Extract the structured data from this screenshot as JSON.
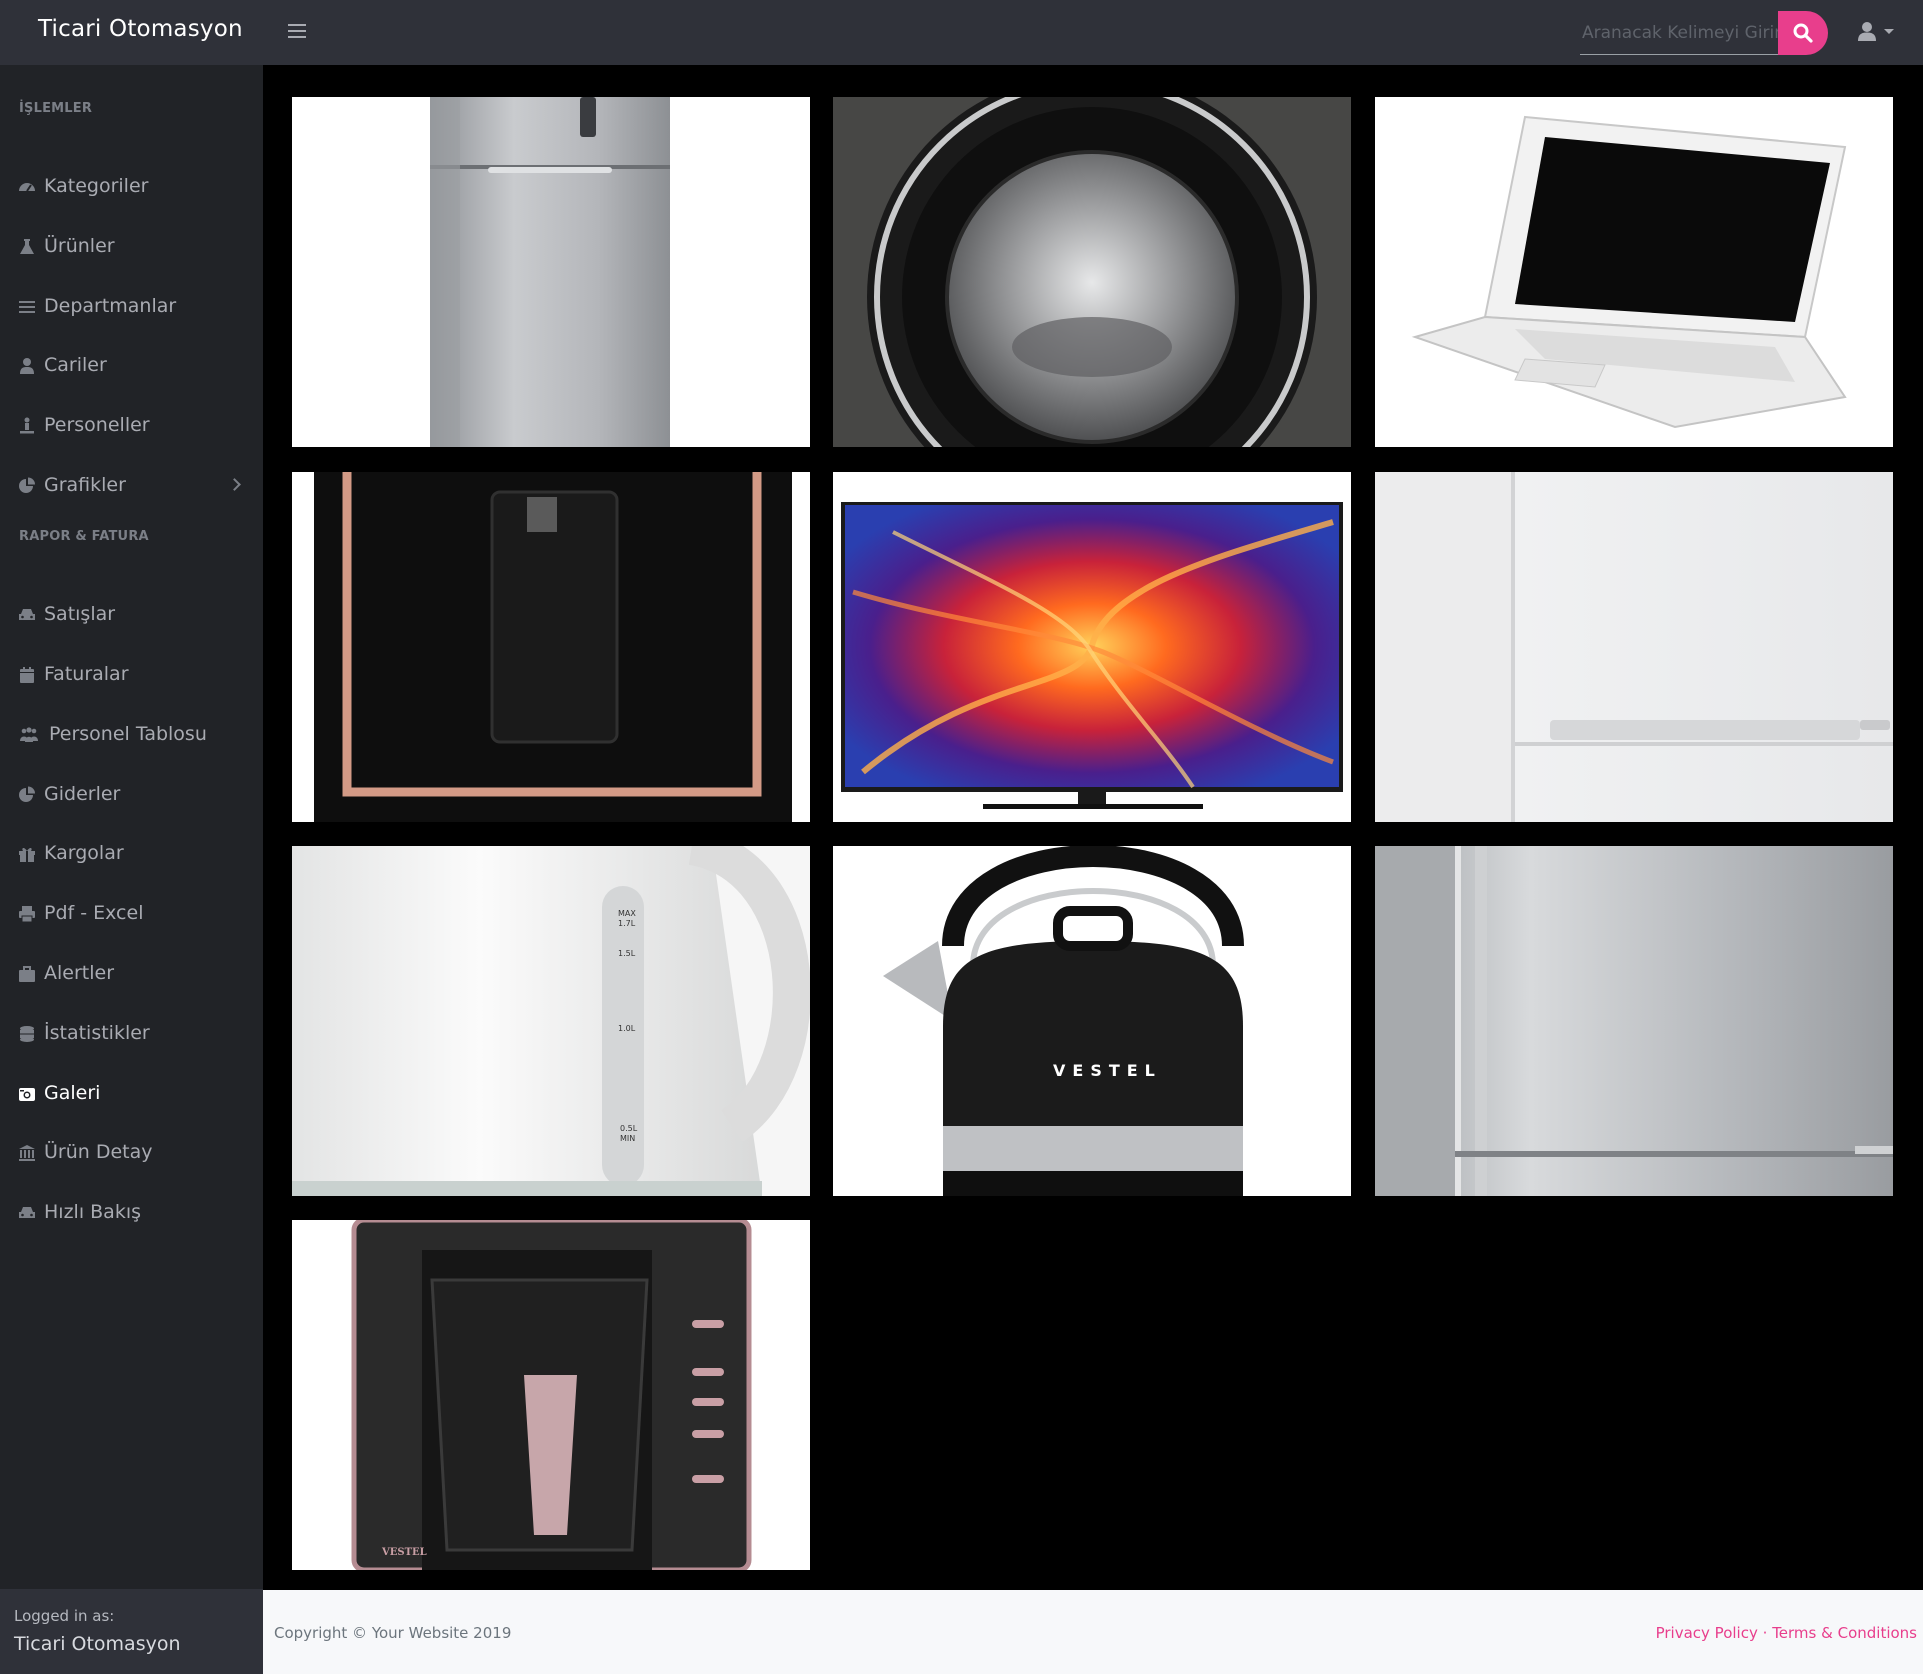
{
  "app": {
    "brand": "Ticari Otomasyon"
  },
  "search": {
    "placeholder": "Aranacak Kelimeyi Giriniz"
  },
  "sidebar": {
    "sections": [
      {
        "heading": "İŞLEMLER"
      },
      {
        "heading": "RAPOR & FATURA"
      }
    ],
    "items": [
      {
        "label": "Kategoriler",
        "icon": "dashboard-icon"
      },
      {
        "label": "Ürünler",
        "icon": "flask-icon"
      },
      {
        "label": "Departmanlar",
        "icon": "list-icon"
      },
      {
        "label": "Cariler",
        "icon": "user-icon"
      },
      {
        "label": "Personeller",
        "icon": "person-icon"
      },
      {
        "label": "Grafikler",
        "icon": "pie-chart-icon"
      },
      {
        "label": "Satışlar",
        "icon": "car-icon"
      },
      {
        "label": "Faturalar",
        "icon": "calendar-icon"
      },
      {
        "label": "Personel Tablosu",
        "icon": "users-icon"
      },
      {
        "label": "Giderler",
        "icon": "pie-chart-icon"
      },
      {
        "label": "Kargolar",
        "icon": "gift-icon"
      },
      {
        "label": "Pdf - Excel",
        "icon": "print-icon"
      },
      {
        "label": "Alertler",
        "icon": "briefcase-icon"
      },
      {
        "label": "İstatistikler",
        "icon": "database-icon"
      },
      {
        "label": "Galeri",
        "icon": "camera-icon"
      },
      {
        "label": "Ürün Detay",
        "icon": "bank-icon"
      },
      {
        "label": "Hızlı Bakış",
        "icon": "car-icon"
      }
    ],
    "active": "Galeri",
    "footer": {
      "logged_in_label": "Logged in as:",
      "user": "Ticari Otomasyon"
    }
  },
  "gallery": {
    "images": [
      {
        "subject": "refrigerator-silver"
      },
      {
        "subject": "washing-machine-door"
      },
      {
        "subject": "laptop-white"
      },
      {
        "subject": "coffee-machine-black-rose"
      },
      {
        "subject": "television"
      },
      {
        "subject": "refrigerator-white"
      },
      {
        "subject": "electric-kettle-white"
      },
      {
        "subject": "stovetop-kettle-vestel"
      },
      {
        "subject": "refrigerator-steel"
      },
      {
        "subject": "turkish-coffee-machine-vestel"
      }
    ],
    "kettle_brand": "VESTEL",
    "coffee_brand": "VESTEL",
    "kettle_marks": [
      "MAX",
      "1.7L",
      "1.5L",
      "1.0L",
      "0.5L",
      "MIN"
    ]
  },
  "footer": {
    "copyright": "Copyright © Your Website 2019",
    "privacy": "Privacy Policy",
    "separator": "·",
    "terms": "Terms & Conditions"
  },
  "colors": {
    "accent": "#e83e8c",
    "topbar": "#2f3139",
    "sidebar": "#212327"
  }
}
